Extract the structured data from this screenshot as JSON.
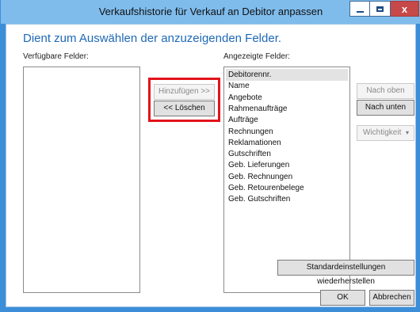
{
  "window": {
    "title": "Verkaufshistorie für Verkauf an Debitor anpassen",
    "controls": {
      "minimize": "–",
      "maximize": "□",
      "close": "x"
    }
  },
  "dialog": {
    "heading": "Dient zum Auswählen der anzuzeigenden Felder.",
    "available_label": "Verfügbare Felder:",
    "displayed_label": "Angezeigte Felder:",
    "available_items": [],
    "displayed_items": [
      "Debitorennr.",
      "Name",
      "Angebote",
      "Rahmenaufträge",
      "Aufträge",
      "Rechnungen",
      "Reklamationen",
      "Gutschriften",
      "Geb. Lieferungen",
      "Geb. Rechnungen",
      "Geb. Retourenbelege",
      "Geb. Gutschriften"
    ],
    "selected_index": 0
  },
  "buttons": {
    "add": "Hinzufügen >>",
    "remove": "<< Löschen",
    "move_up": "Nach oben",
    "move_down": "Nach unten",
    "importance": "Wichtigkeit",
    "reset": "Standardeinstellungen wiederherstellen",
    "ok": "OK",
    "cancel": "Abbrechen"
  },
  "colors": {
    "title_bar": "#7fbcec",
    "heading_text": "#1e69b5",
    "highlight_box": "#e3131a"
  }
}
